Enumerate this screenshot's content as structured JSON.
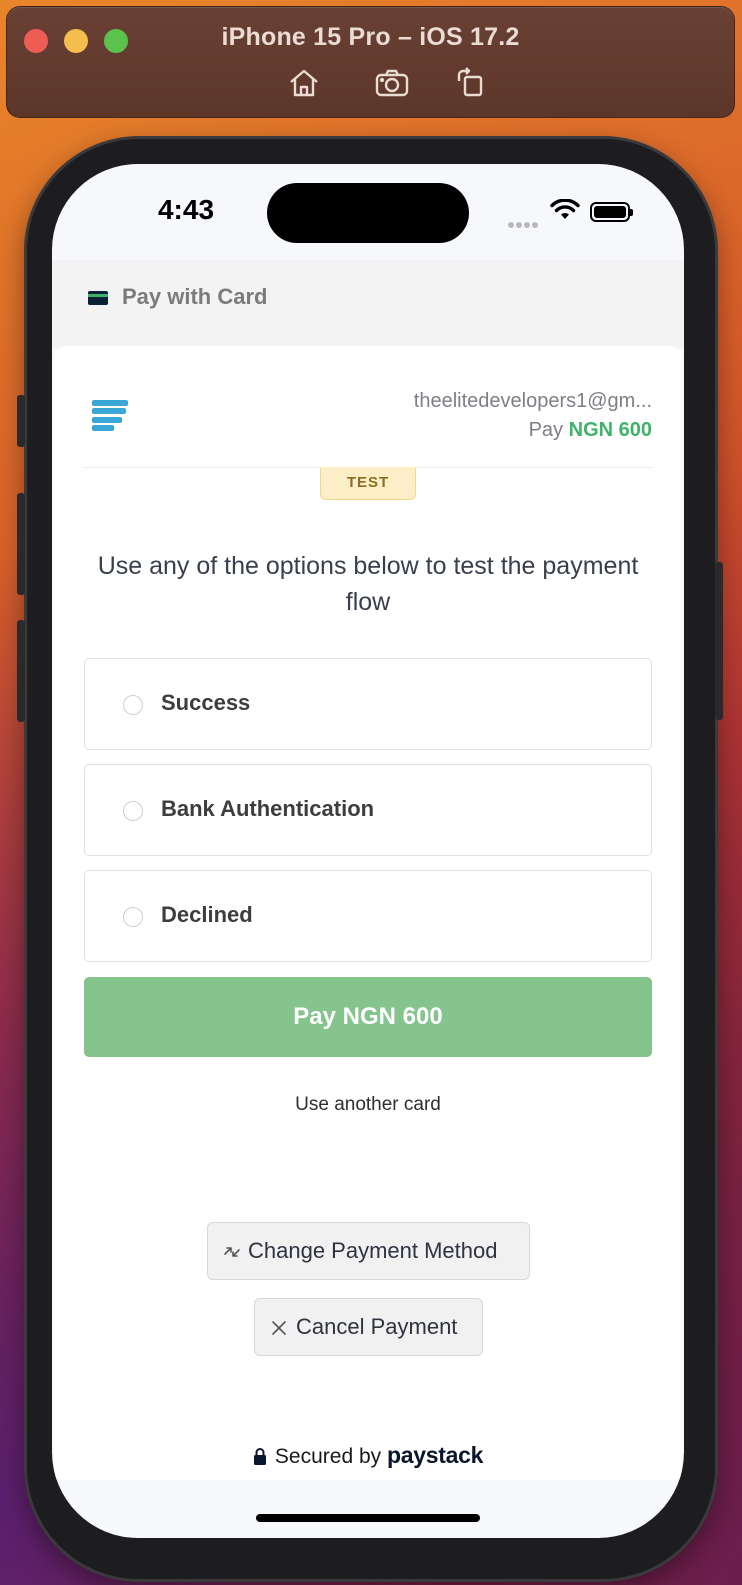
{
  "simulator": {
    "title": "iPhone 15 Pro – iOS 17.2",
    "tools": [
      "home-icon",
      "screenshot-icon",
      "rotate-icon"
    ]
  },
  "status_bar": {
    "time": "4:43"
  },
  "app_header": {
    "icon": "credit-card-icon",
    "title": "Pay with Card"
  },
  "merchant": {
    "email": "theelitedevelopers1@gm...",
    "pay_prefix": "Pay",
    "amount": "NGN 600"
  },
  "badge": "TEST",
  "instruction": "Use any of the options below to test the payment flow",
  "options": [
    {
      "label": "Success"
    },
    {
      "label": "Bank Authentication"
    },
    {
      "label": "Declined"
    }
  ],
  "pay_button": "Pay NGN 600",
  "use_another_card": "Use another card",
  "change_payment_method": "Change Payment Method",
  "cancel_payment": "Cancel Payment",
  "footer": {
    "secured_by": "Secured by",
    "brand": "paystack"
  },
  "colors": {
    "amount_green": "#3fb36b",
    "pay_button_bg": "#85c48d",
    "logo_blue": "#3ba6d8",
    "badge_bg": "#fcefc7"
  }
}
